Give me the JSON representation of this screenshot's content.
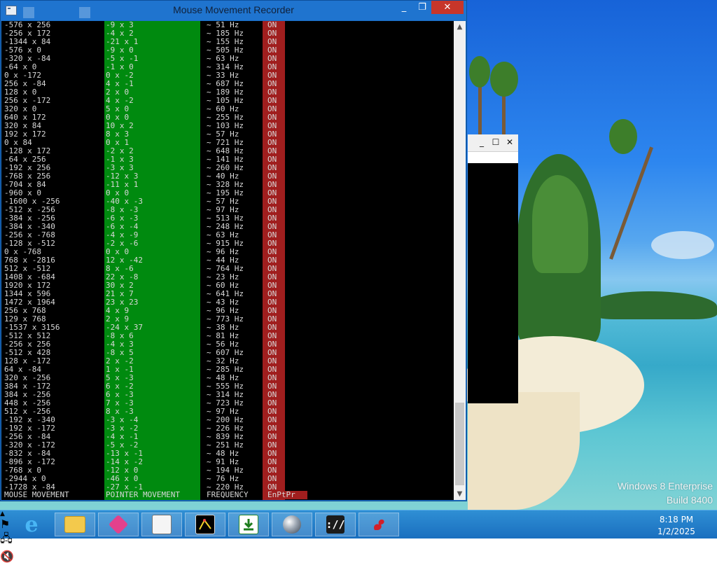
{
  "window": {
    "title": "Mouse Movement Recorder",
    "minimize": "_",
    "maximize": "❐",
    "close": "✕"
  },
  "columns": {
    "mouse": "MOUSE MOVEMENT",
    "pointer": "POINTER MOVEMENT",
    "frequency": "FREQUENCY",
    "flags": "EnPtPr"
  },
  "rows": [
    {
      "mouse": "-576 x 256",
      "ptr": "-9 x 3",
      "freq": "~ 51 Hz",
      "state": "ON"
    },
    {
      "mouse": "-256 x 172",
      "ptr": "-4 x 2",
      "freq": "~ 185 Hz",
      "state": "ON"
    },
    {
      "mouse": "-1344 x 84",
      "ptr": "-21 x 1",
      "freq": "~ 155 Hz",
      "state": "ON"
    },
    {
      "mouse": "-576 x 0",
      "ptr": "-9 x 0",
      "freq": "~ 505 Hz",
      "state": "ON"
    },
    {
      "mouse": "-320 x -84",
      "ptr": "-5 x -1",
      "freq": "~ 63 Hz",
      "state": "ON"
    },
    {
      "mouse": "-64 x 0",
      "ptr": "-1 x 0",
      "freq": "~ 314 Hz",
      "state": "ON"
    },
    {
      "mouse": "0 x -172",
      "ptr": "0 x -2",
      "freq": "~ 33 Hz",
      "state": "ON"
    },
    {
      "mouse": "256 x -84",
      "ptr": "4 x -1",
      "freq": "~ 687 Hz",
      "state": "ON"
    },
    {
      "mouse": "128 x 0",
      "ptr": "2 x 0",
      "freq": "~ 189 Hz",
      "state": "ON"
    },
    {
      "mouse": "256 x -172",
      "ptr": "4 x -2",
      "freq": "~ 105 Hz",
      "state": "ON"
    },
    {
      "mouse": "320 x 0",
      "ptr": "5 x 0",
      "freq": "~ 60 Hz",
      "state": "ON"
    },
    {
      "mouse": "640 x 172",
      "ptr": "0 x 0",
      "freq": "~ 255 Hz",
      "state": "ON"
    },
    {
      "mouse": "320 x 84",
      "ptr": "10 x 2",
      "freq": "~ 103 Hz",
      "state": "ON"
    },
    {
      "mouse": "192 x 172",
      "ptr": "8 x 3",
      "freq": "~ 57 Hz",
      "state": "ON"
    },
    {
      "mouse": "0 x 84",
      "ptr": "0 x 1",
      "freq": "~ 721 Hz",
      "state": "ON"
    },
    {
      "mouse": "-128 x 172",
      "ptr": "-2 x 2",
      "freq": "~ 648 Hz",
      "state": "ON"
    },
    {
      "mouse": "-64 x 256",
      "ptr": "-1 x 3",
      "freq": "~ 141 Hz",
      "state": "ON"
    },
    {
      "mouse": "-192 x 256",
      "ptr": "-3 x 3",
      "freq": "~ 260 Hz",
      "state": "ON"
    },
    {
      "mouse": "-768 x 256",
      "ptr": "-12 x 3",
      "freq": "~ 40 Hz",
      "state": "ON"
    },
    {
      "mouse": "-704 x 84",
      "ptr": "-11 x 1",
      "freq": "~ 328 Hz",
      "state": "ON"
    },
    {
      "mouse": "-960 x 0",
      "ptr": "0 x 0",
      "freq": "~ 195 Hz",
      "state": "ON"
    },
    {
      "mouse": "-1600 x -256",
      "ptr": "-40 x -3",
      "freq": "~ 57 Hz",
      "state": "ON"
    },
    {
      "mouse": "-512 x -256",
      "ptr": "-8 x -3",
      "freq": "~ 97 Hz",
      "state": "ON"
    },
    {
      "mouse": "-384 x -256",
      "ptr": "-6 x -3",
      "freq": "~ 513 Hz",
      "state": "ON"
    },
    {
      "mouse": "-384 x -340",
      "ptr": "-6 x -4",
      "freq": "~ 248 Hz",
      "state": "ON"
    },
    {
      "mouse": "-256 x -768",
      "ptr": "-4 x -9",
      "freq": "~ 63 Hz",
      "state": "ON"
    },
    {
      "mouse": "-128 x -512",
      "ptr": "-2 x -6",
      "freq": "~ 915 Hz",
      "state": "ON"
    },
    {
      "mouse": "0 x -768",
      "ptr": "0 x 0",
      "freq": "~ 96 Hz",
      "state": "ON"
    },
    {
      "mouse": "768 x -2816",
      "ptr": "12 x -42",
      "freq": "~ 44 Hz",
      "state": "ON"
    },
    {
      "mouse": "512 x -512",
      "ptr": "8 x -6",
      "freq": "~ 764 Hz",
      "state": "ON"
    },
    {
      "mouse": "1408 x -684",
      "ptr": "22 x -8",
      "freq": "~ 23 Hz",
      "state": "ON"
    },
    {
      "mouse": "1920 x 172",
      "ptr": "30 x 2",
      "freq": "~ 60 Hz",
      "state": "ON"
    },
    {
      "mouse": "1344 x 596",
      "ptr": "21 x 7",
      "freq": "~ 641 Hz",
      "state": "ON"
    },
    {
      "mouse": "1472 x 1964",
      "ptr": "23 x 23",
      "freq": "~ 43 Hz",
      "state": "ON"
    },
    {
      "mouse": "256 x 768",
      "ptr": "4 x 9",
      "freq": "~ 96 Hz",
      "state": "ON"
    },
    {
      "mouse": "129 x 768",
      "ptr": "2 x 9",
      "freq": "~ 773 Hz",
      "state": "ON"
    },
    {
      "mouse": "-1537 x 3156",
      "ptr": "-24 x 37",
      "freq": "~ 38 Hz",
      "state": "ON"
    },
    {
      "mouse": "-512 x 512",
      "ptr": "-8 x 6",
      "freq": "~ 81 Hz",
      "state": "ON"
    },
    {
      "mouse": "-256 x 256",
      "ptr": "-4 x 3",
      "freq": "~ 56 Hz",
      "state": "ON"
    },
    {
      "mouse": "-512 x 428",
      "ptr": "-8 x 5",
      "freq": "~ 607 Hz",
      "state": "ON"
    },
    {
      "mouse": "128 x -172",
      "ptr": "2 x -2",
      "freq": "~ 32 Hz",
      "state": "ON"
    },
    {
      "mouse": "64 x -84",
      "ptr": "1 x -1",
      "freq": "~ 285 Hz",
      "state": "ON"
    },
    {
      "mouse": "320 x -256",
      "ptr": "5 x -3",
      "freq": "~ 48 Hz",
      "state": "ON"
    },
    {
      "mouse": "384 x -172",
      "ptr": "6 x -2",
      "freq": "~ 555 Hz",
      "state": "ON"
    },
    {
      "mouse": "384 x -256",
      "ptr": "6 x -3",
      "freq": "~ 314 Hz",
      "state": "ON"
    },
    {
      "mouse": "448 x -256",
      "ptr": "7 x -3",
      "freq": "~ 723 Hz",
      "state": "ON"
    },
    {
      "mouse": "512 x -256",
      "ptr": "8 x -3",
      "freq": "~ 97 Hz",
      "state": "ON"
    },
    {
      "mouse": "-192 x -340",
      "ptr": "-3 x -4",
      "freq": "~ 200 Hz",
      "state": "ON"
    },
    {
      "mouse": "-192 x -172",
      "ptr": "-3 x -2",
      "freq": "~ 226 Hz",
      "state": "ON"
    },
    {
      "mouse": "-256 x -84",
      "ptr": "-4 x -1",
      "freq": "~ 839 Hz",
      "state": "ON"
    },
    {
      "mouse": "-320 x -172",
      "ptr": "-5 x -2",
      "freq": "~ 251 Hz",
      "state": "ON"
    },
    {
      "mouse": "-832 x -84",
      "ptr": "-13 x -1",
      "freq": "~ 48 Hz",
      "state": "ON"
    },
    {
      "mouse": "-896 x -172",
      "ptr": "-14 x -2",
      "freq": "~ 91 Hz",
      "state": "ON"
    },
    {
      "mouse": "-768 x 0",
      "ptr": "-12 x 0",
      "freq": "~ 194 Hz",
      "state": "ON"
    },
    {
      "mouse": "-2944 x 0",
      "ptr": "-46 x 0",
      "freq": "~ 76 Hz",
      "state": "ON"
    },
    {
      "mouse": "-1728 x -84",
      "ptr": "-27 x -1",
      "freq": "~ 220 Hz",
      "state": "ON"
    }
  ],
  "desktop": {
    "watermark_line1": "Windows 8 Enterprise",
    "watermark_line2": "Build 8400"
  },
  "taskbar": {
    "items": [
      {
        "name": "internet-explorer",
        "icon": "ie-icon",
        "glyph": "e"
      },
      {
        "name": "file-explorer",
        "icon": "folder-icon",
        "glyph": ""
      },
      {
        "name": "app-pink",
        "icon": "pink-app-icon",
        "glyph": ""
      },
      {
        "name": "app-window",
        "icon": "window-app-icon",
        "glyph": ""
      },
      {
        "name": "app-graph",
        "icon": "graph-app-icon",
        "glyph": ""
      },
      {
        "name": "app-download",
        "icon": "download-app-icon",
        "glyph": ""
      },
      {
        "name": "app-sphere",
        "icon": "sphere-app-icon",
        "glyph": ""
      },
      {
        "name": "app-console",
        "icon": "console-app-icon",
        "glyph": "://"
      },
      {
        "name": "app-squirrel",
        "icon": "squirrel-app-icon",
        "glyph": ""
      }
    ],
    "clock_time": "8:18 PM",
    "clock_date": "1/2/2025"
  },
  "colors": {
    "pointer_column": "#008a0f",
    "flags_column": "#a01e1e",
    "title_bar": "#1f74cf",
    "close_button": "#c7362a",
    "taskbar": "#1a6fbf"
  }
}
